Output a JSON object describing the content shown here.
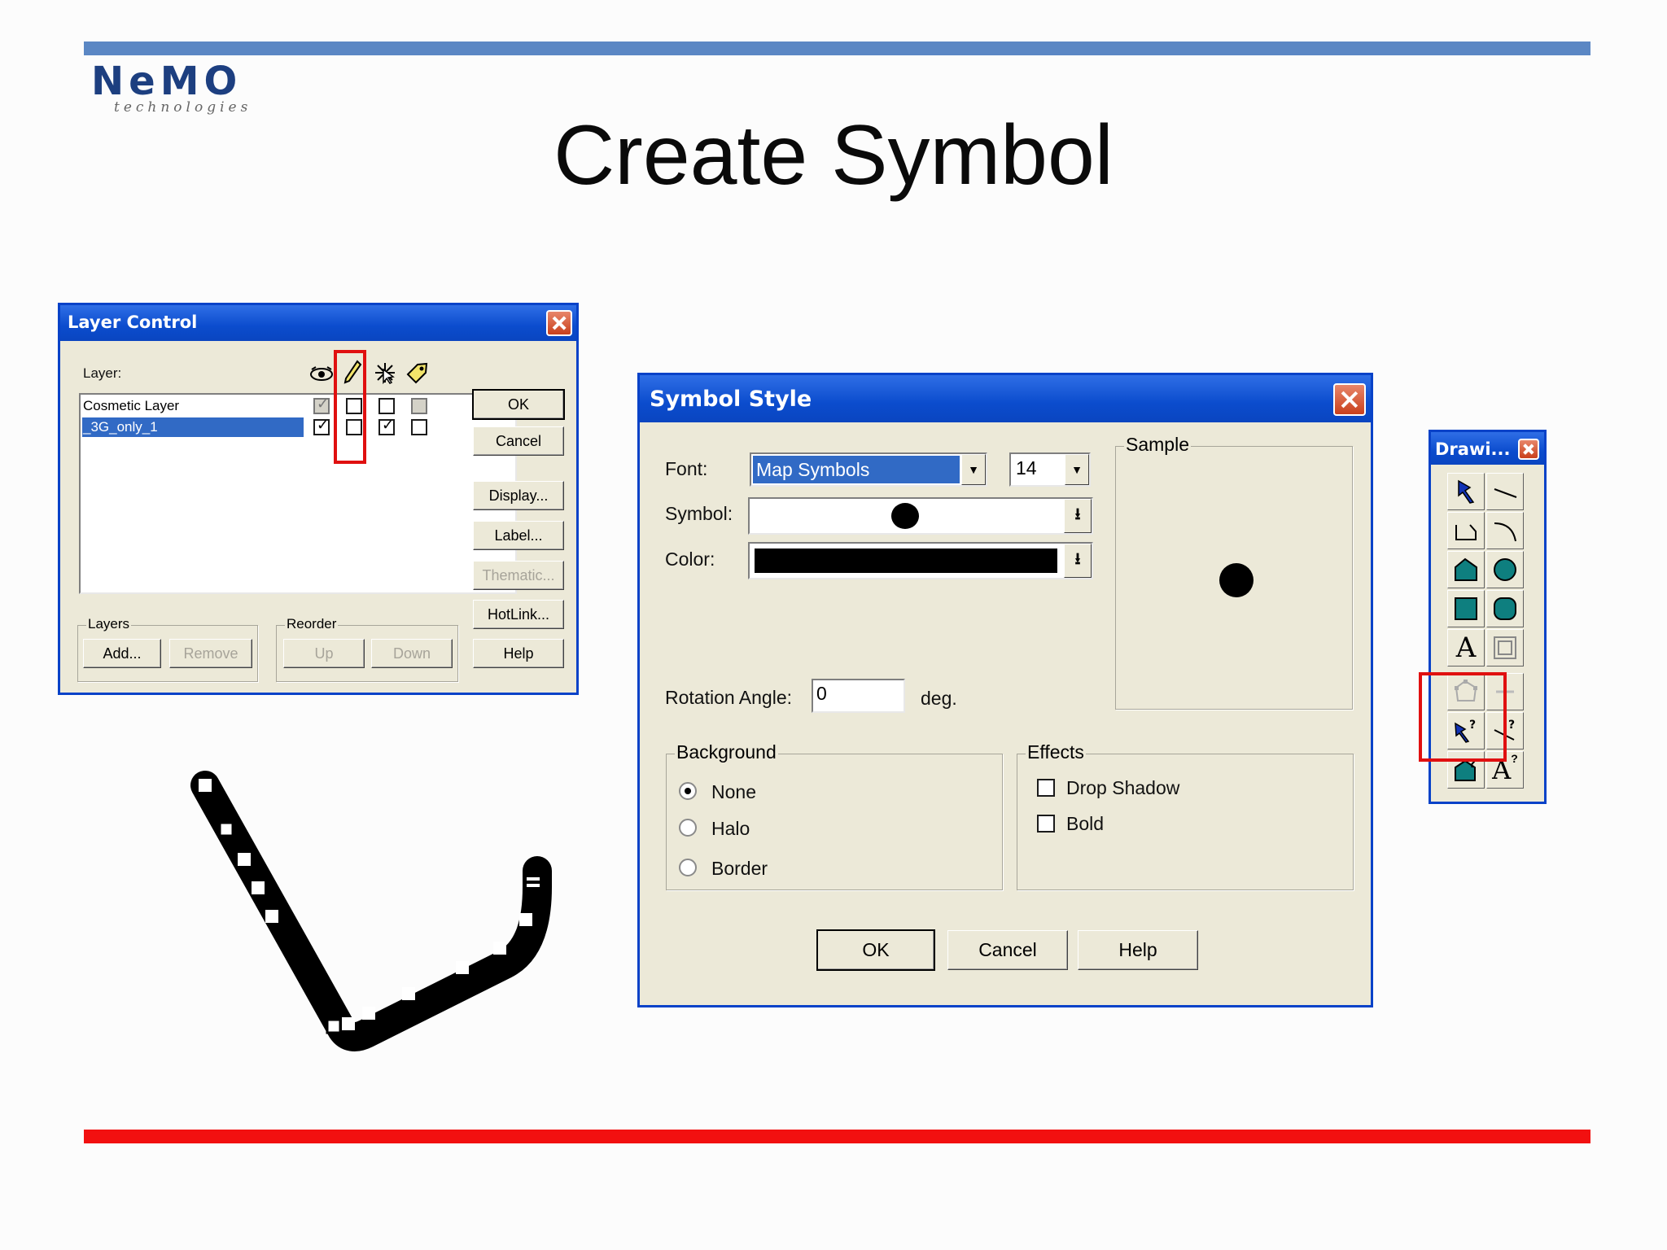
{
  "slide": {
    "title": "Create Symbol",
    "logo_word": "NeMO",
    "logo_sub": "technologies",
    "colors": {
      "top_bar": "#5b87c4",
      "bottom_bar": "#f21010",
      "title_bar": "#0b4ccd",
      "highlight": "#e01010"
    }
  },
  "layer_control": {
    "title": "Layer Control",
    "layer_label": "Layer:",
    "column_icons": [
      "eye-icon",
      "pencil-icon",
      "select-arrow-icon",
      "label-tag-icon"
    ],
    "rows": [
      {
        "name": "Cosmetic Layer",
        "selected": false,
        "visible": "grayed-checked",
        "editable": false,
        "selectable": false,
        "labels": "grayed"
      },
      {
        "name": "_3G_only_1",
        "selected": true,
        "visible": "checked",
        "editable": false,
        "selectable": true,
        "labels": false
      }
    ],
    "buttons": {
      "ok": "OK",
      "cancel": "Cancel",
      "display": "Display...",
      "label": "Label...",
      "thematic": "Thematic...",
      "hotlink": "HotLink...",
      "help": "Help"
    },
    "layers_group": {
      "caption": "Layers",
      "add": "Add...",
      "remove": "Remove"
    },
    "reorder_group": {
      "caption": "Reorder",
      "up": "Up",
      "down": "Down"
    }
  },
  "symbol_style": {
    "title": "Symbol Style",
    "font_label": "Font:",
    "font_value": "Map Symbols",
    "size_value": "14",
    "symbol_label": "Symbol:",
    "color_label": "Color:",
    "color_value": "#000000",
    "rotation_label": "Rotation Angle:",
    "rotation_value": "0",
    "rotation_unit": "deg.",
    "sample_caption": "Sample",
    "background": {
      "caption": "Background",
      "options": [
        "None",
        "Halo",
        "Border"
      ],
      "selected": "None"
    },
    "effects": {
      "caption": "Effects",
      "drop_shadow": "Drop Shadow",
      "bold": "Bold",
      "drop_shadow_checked": false,
      "bold_checked": false
    },
    "buttons": {
      "ok": "OK",
      "cancel": "Cancel",
      "help": "Help"
    }
  },
  "drawing_toolbar": {
    "title": "Drawi...",
    "tools": [
      "symbol-pin-icon",
      "line-icon",
      "polyline-icon",
      "arc-icon",
      "polygon-icon",
      "ellipse-icon",
      "rectangle-icon",
      "rounded-rectangle-icon",
      "text-icon",
      "frame-icon",
      "reshape-icon",
      "add-node-icon",
      "symbol-query-icon",
      "line-query-icon",
      "polygon-query-icon",
      "text-query-icon"
    ]
  }
}
